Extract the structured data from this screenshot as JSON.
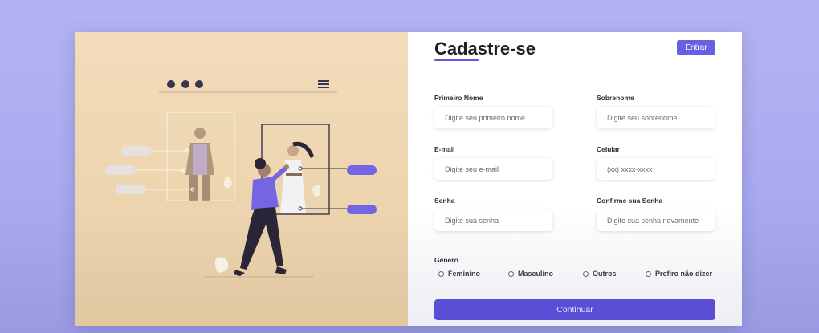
{
  "page": {
    "title": "Cadastre-se",
    "login_button": "Entrar",
    "submit_button": "Continuar"
  },
  "fields": {
    "first_name": {
      "label": "Primeiro Nome",
      "placeholder": "Digite seu primeiro nome"
    },
    "last_name": {
      "label": "Sobrenome",
      "placeholder": "Digite seu sobrenome"
    },
    "email": {
      "label": "E-mail",
      "placeholder": "Digite seu e-mail"
    },
    "phone": {
      "label": "Celular",
      "placeholder": "(xx) xxxx-xxxx"
    },
    "password": {
      "label": "Senha",
      "placeholder": "Digite sua senha"
    },
    "confirm_password": {
      "label": "Confirme sua Senha",
      "placeholder": "Digite sua senha novamente"
    }
  },
  "gender": {
    "label": "Gênero",
    "options": [
      "Feminino",
      "Masculino",
      "Outros",
      "Prefiro não dizer"
    ]
  },
  "illustration": {
    "icons": [
      "window-dots-icon",
      "hamburger-menu-icon",
      "person-figure-icon",
      "woman-figure-icon"
    ],
    "colors": {
      "accent": "#7466e3",
      "skin": "#a17f6a",
      "dark": "#2a2537"
    }
  },
  "colors": {
    "brand": "#5a4ed6",
    "background": "#b3b3f4",
    "panel": "#f2dcba"
  }
}
